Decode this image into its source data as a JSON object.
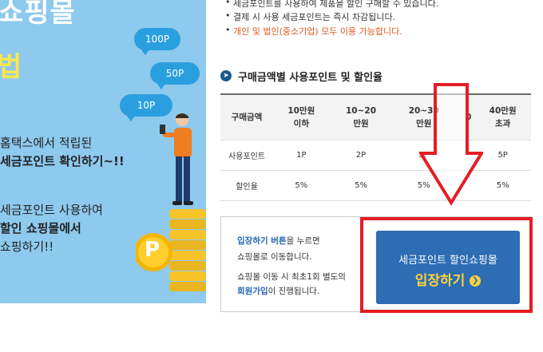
{
  "banner": {
    "title_line1": "쇼핑몰",
    "title_line2": "법",
    "bubbles": [
      "100P",
      "50P",
      "10P"
    ],
    "text1_line1": "홈택스에서 적립된",
    "text1_line2": "세금포인트 확인하기~!!",
    "text2_line1": "세금포인트 사용하여",
    "text2_line2": "할인 쇼핑몰에서",
    "text2_line3": "쇼핑하기!!",
    "coin_label": "P"
  },
  "notes": [
    "세금포인트를 사용하여 제품을 할인 구매할 수 있습니다.",
    "결제 시 사용 세금포인트는 즉시 차감됩니다.",
    "개인 및 법인(중소기업) 모두 이용 가능합니다."
  ],
  "section": {
    "icon": "arrow-circle-icon",
    "title": "구매금액별 사용포인트 및 할인율"
  },
  "table": {
    "header_label": "구매금액",
    "columns": [
      [
        "10만원",
        "이하"
      ],
      [
        "10~20",
        "만원"
      ],
      [
        "20~30",
        "만원"
      ],
      [
        "0",
        ""
      ],
      [
        "40만원",
        "초과"
      ]
    ],
    "rows": [
      {
        "label": "사용포인트",
        "values": [
          "1P",
          "2P",
          "3P",
          "",
          "5P"
        ]
      },
      {
        "label": "할인율",
        "values": [
          "5%",
          "5%",
          "5%",
          "",
          "5%"
        ]
      }
    ]
  },
  "info": {
    "line1_link": "입장하기 버튼",
    "line1_rest": "을 누르면",
    "line2": "쇼핑몰로 이동합니다.",
    "line3": "쇼핑몰 이동 시 최초1회 별도의",
    "line4_link": "회원가입",
    "line4_rest": "이 진행됩니다."
  },
  "cta": {
    "line1": "세금포인트 할인쇼핑몰",
    "line2": "입장하기",
    "icon": "chevron-circle-right-icon"
  },
  "colors": {
    "banner_bg": "#8ec9ee",
    "bubble": "#2a9fe0",
    "button": "#2d6db4",
    "button_highlight": "#ffd23a",
    "annotation_red": "#e31e24",
    "note_orange": "#e05a1e"
  }
}
